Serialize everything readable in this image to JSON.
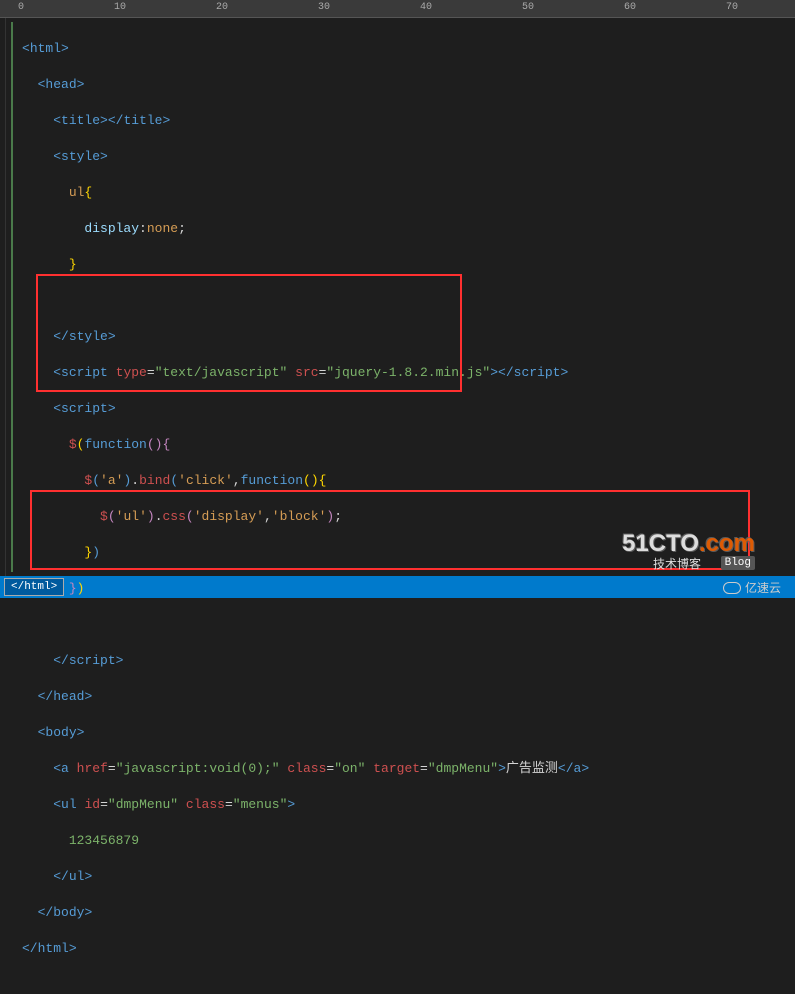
{
  "ruler": {
    "marks": [
      0,
      10,
      20,
      30,
      40,
      50,
      60,
      70
    ]
  },
  "code": {
    "l1": {
      "open": "<",
      "tag": "html",
      "close": ">"
    },
    "l2": {
      "open": "<",
      "tag": "head",
      "close": ">"
    },
    "l3": {
      "open": "<",
      "tag": "title",
      "close": ">",
      "open2": "</",
      "tag2": "title",
      "close2": ">"
    },
    "l4": {
      "open": "<",
      "tag": "style",
      "close": ">"
    },
    "l5": {
      "text": "ul",
      "brace": "{"
    },
    "l6": {
      "prop": "display",
      "colon": ":",
      "val": "none",
      "semi": ";"
    },
    "l7": {
      "brace": "}"
    },
    "l9": {
      "open": "</",
      "tag": "style",
      "close": ">"
    },
    "l10": {
      "open": "<",
      "tag": "script",
      "sp": " ",
      "attr1": "type",
      "eq": "=",
      "q": "\"",
      "val1": "text/javascript",
      "attr2": "src",
      "val2": "jquery-1.8.2.min.js",
      "close": ">",
      "open2": "</",
      "tag2": "script",
      "close2": ">"
    },
    "l11": {
      "open": "<",
      "tag": "script",
      "close": ">"
    },
    "l12": {
      "dollar": "$",
      "lp": "(",
      "kw": "function",
      "lp2": "(",
      "rp2": ")",
      "brace": "{"
    },
    "l13": {
      "dollar": "$",
      "lp": "(",
      "q": "'",
      "sel": "a",
      "rp": ")",
      "dot": ".",
      "fn": "bind",
      "lp2": "(",
      "arg1": "click",
      "comma": ",",
      "kw": "function",
      "lp3": "(",
      "rp3": ")",
      "brace": "{"
    },
    "l14": {
      "dollar": "$",
      "lp": "(",
      "q": "'",
      "sel": "ul",
      "rp": ")",
      "dot": ".",
      "fn": "css",
      "lp2": "(",
      "arg1": "display",
      "comma": ",",
      "arg2": "block",
      "rp2": ")",
      "semi": ";"
    },
    "l15": {
      "brace": "}",
      "rp": ")"
    },
    "l16": {
      "brace": "}",
      "rp": ")"
    },
    "l18": {
      "open": "</",
      "tag": "script",
      "close": ">"
    },
    "l19": {
      "open": "</",
      "tag": "head",
      "close": ">"
    },
    "l20": {
      "open": "<",
      "tag": "body",
      "close": ">"
    },
    "l21": {
      "open": "<",
      "tag": "a",
      "sp": " ",
      "attr1": "href",
      "eq": "=",
      "q": "\"",
      "val1": "javascript:void(0);",
      "attr2": "class",
      "val2": "on",
      "attr3": "target",
      "val3": "dmpMenu",
      "close": ">",
      "text": "广告监测",
      "open2": "</",
      "tag2": "a",
      "close2": ">"
    },
    "l22": {
      "open": "<",
      "tag": "ul",
      "sp": " ",
      "attr1": "id",
      "eq": "=",
      "q": "\"",
      "val1": "dmpMenu",
      "attr2": "class",
      "val2": "menus",
      "close": ">"
    },
    "l23": {
      "text": "123456879"
    },
    "l24": {
      "open": "</",
      "tag": "ul",
      "close": ">"
    },
    "l25": {
      "open": "</",
      "tag": "body",
      "close": ">"
    },
    "l26": {
      "open": "</",
      "tag": "html",
      "close": ">"
    }
  },
  "status": {
    "close_tag": "</html>"
  },
  "watermarks": {
    "w1_main": "51CTO",
    "w1_suffix": ".com",
    "w1_sub": "技术博客",
    "w1_blog": "Blog",
    "w2": "亿速云"
  }
}
